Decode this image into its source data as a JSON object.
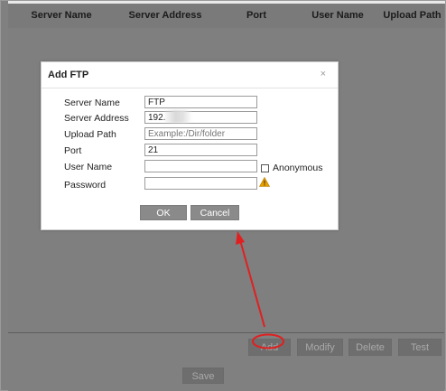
{
  "table": {
    "columns": [
      "Server Name",
      "Server Address",
      "Port",
      "User Name",
      "Upload Path"
    ]
  },
  "dialog": {
    "title": "Add FTP",
    "close_glyph": "×",
    "fields": [
      {
        "label": "Server Name",
        "value": "FTP",
        "placeholder": ""
      },
      {
        "label": "Server Address",
        "value": "192.",
        "placeholder": ""
      },
      {
        "label": "Upload Path",
        "value": "",
        "placeholder": "Example:/Dir/folder"
      },
      {
        "label": "Port",
        "value": "21",
        "placeholder": ""
      },
      {
        "label": "User Name",
        "value": "",
        "placeholder": ""
      },
      {
        "label": "Password",
        "value": "",
        "placeholder": ""
      }
    ],
    "anonymous": {
      "label": "Anonymous",
      "checked": false
    },
    "password_warning_icon": "warning-icon",
    "ok_label": "OK",
    "cancel_label": "Cancel"
  },
  "actions": {
    "add_label": "Add",
    "modify_label": "Modify",
    "delete_label": "Delete",
    "test_label": "Test",
    "save_label": "Save"
  },
  "annotation": {
    "color": "#e02020",
    "target": "Add"
  },
  "colors": {
    "dim_background": "#808080",
    "button_gray": "#8a8a8a",
    "warning": "#e6a100"
  }
}
